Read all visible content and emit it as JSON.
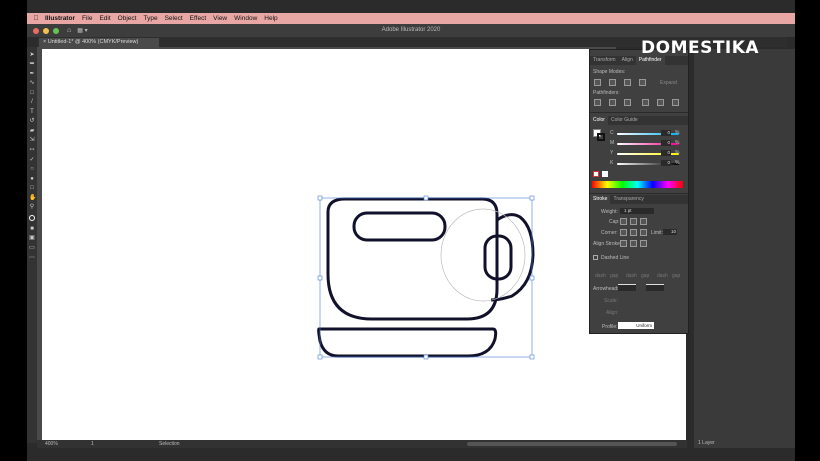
{
  "menubar": {
    "app": "Illustrator",
    "items": [
      "File",
      "Edit",
      "Object",
      "Type",
      "Select",
      "Effect",
      "View",
      "Window",
      "Help"
    ]
  },
  "window": {
    "title": "Adobe Illustrator 2020"
  },
  "document": {
    "tab": "Untitled-1* @ 400% (CMYK/Preview)"
  },
  "watermark": {
    "text": "DOMESTIKA"
  },
  "status": {
    "zoom": "400%",
    "artboard": "1",
    "tool": "Selection"
  },
  "panels": {
    "top_tabs": [
      "Transform",
      "Align",
      "Pathfinder"
    ],
    "shape_modes": "Shape Modes:",
    "expand": "Expand",
    "pathfinders": "Pathfinders:",
    "color_tabs": [
      "Color",
      "Color Guide"
    ],
    "channels": [
      {
        "label": "C",
        "value": "0",
        "unit": "%"
      },
      {
        "label": "M",
        "value": "0",
        "unit": "%"
      },
      {
        "label": "Y",
        "value": "0",
        "unit": "%"
      },
      {
        "label": "K",
        "value": "0",
        "unit": "%"
      }
    ],
    "stroke_tabs": [
      "Stroke",
      "Transparency"
    ],
    "weight_label": "Weight:",
    "weight_value": "1 pt",
    "cap_label": "Cap:",
    "corner_label": "Corner:",
    "limit_label": "Limit:",
    "limit_value": "10",
    "align_stroke_label": "Align Stroke:",
    "dashed_line": "Dashed Line",
    "dash_labels": [
      "dash",
      "gap",
      "dash",
      "gap",
      "dash",
      "gap"
    ],
    "arrowheads_label": "Arrowheads:",
    "scale_label": "Scale:",
    "align_label": "Align:",
    "profile_label": "Profile:",
    "profile_value": "Uniform"
  },
  "layers": {
    "count": "1 Layer"
  },
  "colors": {
    "menubar": "#e8a7a4",
    "stroke": "#12112b",
    "selection": "#4a7fd6"
  }
}
